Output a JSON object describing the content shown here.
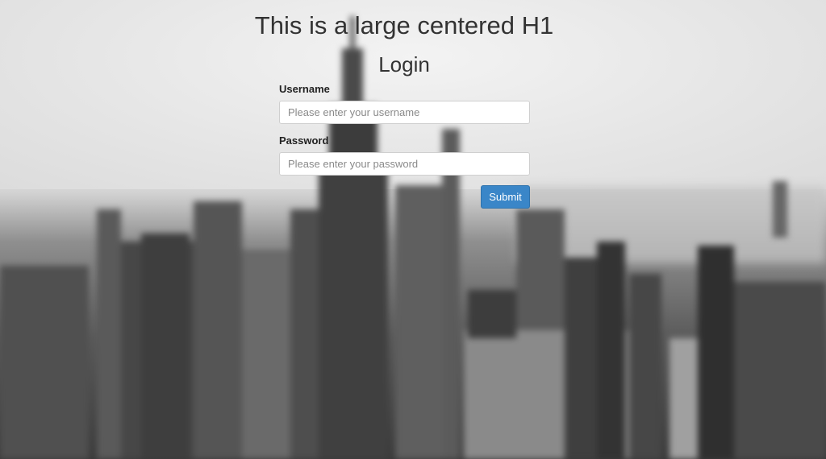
{
  "page": {
    "heading": "This is a large centered H1",
    "subheading": "Login"
  },
  "form": {
    "username": {
      "label": "Username",
      "placeholder": "Please enter your username",
      "value": ""
    },
    "password": {
      "label": "Password",
      "placeholder": "Please enter your password",
      "value": ""
    },
    "submit_label": "Submit"
  },
  "colors": {
    "accent": "#3a86c8",
    "text": "#333333"
  }
}
